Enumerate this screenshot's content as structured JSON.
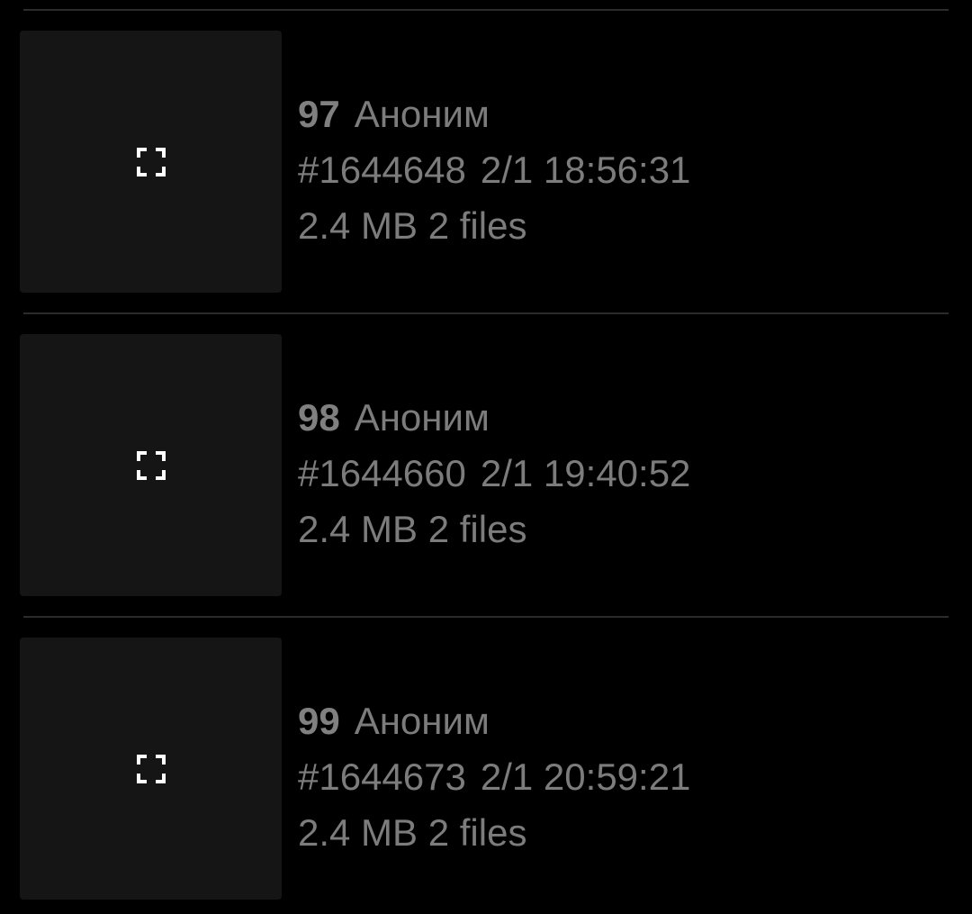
{
  "posts": [
    {
      "number": "97",
      "author": "Аноним",
      "post_id": "#1644648",
      "datetime": "2/1 18:56:31",
      "size": "2.4 MB",
      "files": "2 files",
      "icon": "fullscreen-icon"
    },
    {
      "number": "98",
      "author": "Аноним",
      "post_id": "#1644660",
      "datetime": "2/1 19:40:52",
      "size": "2.4 MB",
      "files": "2 files",
      "icon": "fullscreen-icon"
    },
    {
      "number": "99",
      "author": "Аноним",
      "post_id": "#1644673",
      "datetime": "2/1 20:59:21",
      "size": "2.4 MB",
      "files": "2 files",
      "icon": "fullscreen-icon"
    }
  ],
  "colors": {
    "background": "#000000",
    "thumbnail": "#151515",
    "text": "#7c7c7c",
    "divider": "#2b2b2b",
    "icon": "#ffffff"
  }
}
